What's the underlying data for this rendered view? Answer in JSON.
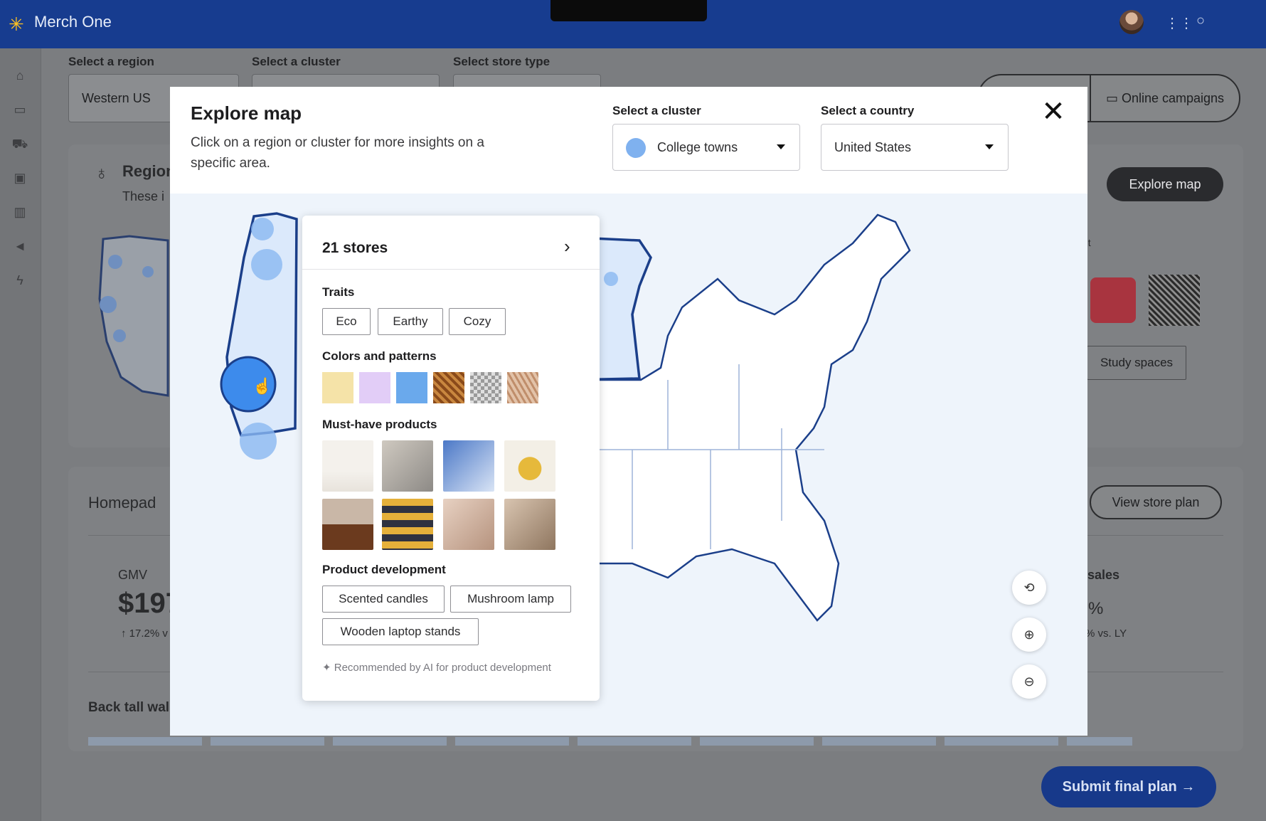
{
  "app": {
    "title": "Merch One",
    "logo_icon": "spark-icon"
  },
  "topbar": {
    "apps_icon": "grid-icon",
    "chat_icon": "chat-icon"
  },
  "sidenav": {
    "icons": [
      "home-icon",
      "calendar-icon",
      "cart-icon",
      "truck-icon",
      "bar-chart-icon",
      "megaphone-icon",
      "lightning-icon"
    ]
  },
  "filters": {
    "region_label": "Select a region",
    "region_value": "Western US",
    "cluster_label": "Select a cluster",
    "store_type_label": "Select store type"
  },
  "background": {
    "online_campaigns": "Online campaigns",
    "region_title": "Region",
    "region_desc": "These i",
    "explore_map_button": "Explore map",
    "partial_label": "nt",
    "study_spaces": "Study spaces",
    "homepad_title": "Homepad",
    "view_store_plan": "View store plan",
    "gmv_label": "GMV",
    "gmv_value": "$197",
    "gmv_change": "↑ 17.2% v",
    "sales_label": ": sales",
    "sales_value": "%",
    "sales_change": "% vs. LY",
    "back_tall": "Back tall wal"
  },
  "modal": {
    "title": "Explore map",
    "subtitle": "Click on a region or cluster for more insights on a specific area.",
    "cluster_label": "Select a cluster",
    "cluster_value": "College towns",
    "country_label": "Select a country",
    "country_value": "United States"
  },
  "popover": {
    "stores": "21 stores",
    "traits_title": "Traits",
    "traits": [
      "Eco",
      "Earthy",
      "Cozy"
    ],
    "colors_title": "Colors and patterns",
    "colors": [
      "#f5e3a8",
      "#e2cdf7",
      "#6aa9ec",
      "#8a4a1a",
      "#bdbdbd",
      "#d3a98a"
    ],
    "products_title": "Must-have products",
    "product_dev_title": "Product development",
    "product_dev": [
      "Scented candles",
      "Mushroom lamp",
      "Wooden laptop stands"
    ],
    "ai_note": "Recommended by AI for product development"
  },
  "submit": {
    "label": "Submit final plan →"
  },
  "colors": {
    "brand_blue": "#173c8f",
    "accent_yellow": "#ffc220",
    "cluster_blue": "#7fb1ef"
  }
}
